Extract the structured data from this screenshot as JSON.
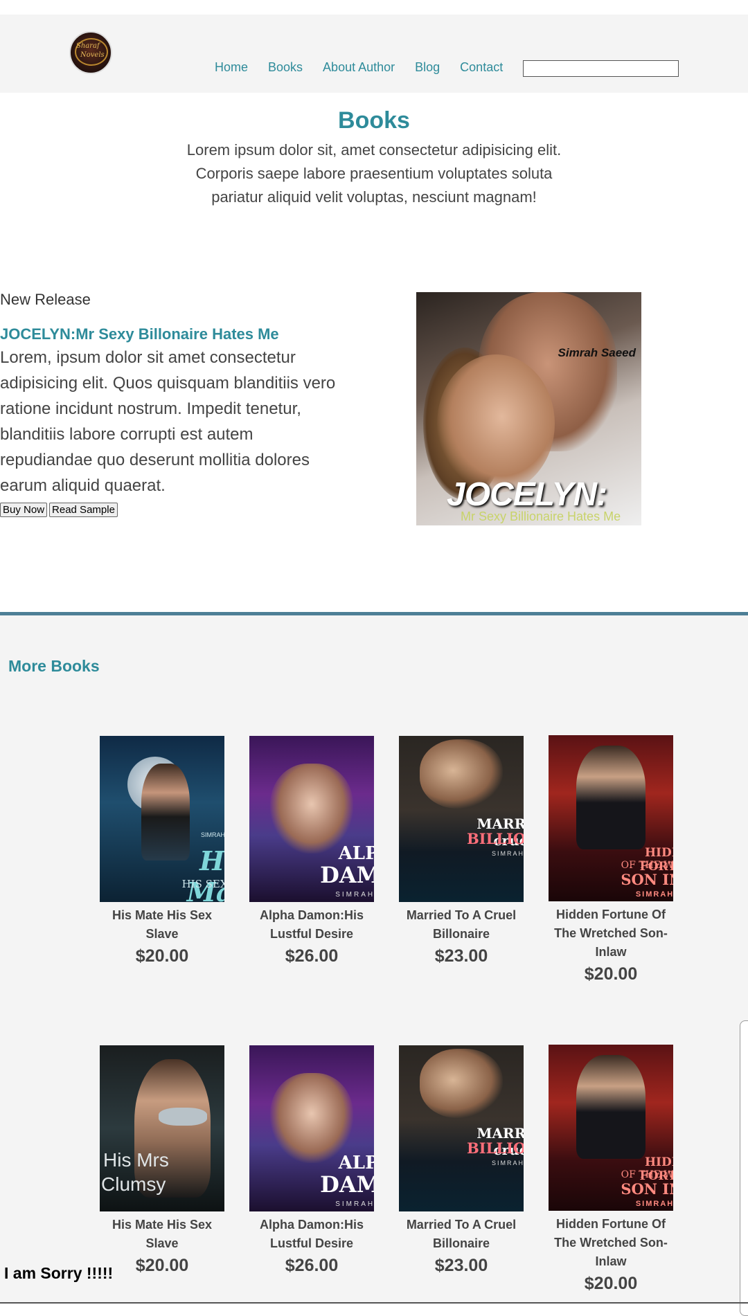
{
  "header": {
    "logo_text_line1": "Sharaf",
    "logo_text_line2": "Novels",
    "nav": [
      "Home",
      "Books",
      "About Author",
      "Blog",
      "Contact"
    ],
    "search_value": ""
  },
  "hero": {
    "title": "Books",
    "description_lines": [
      "Lorem ipsum dolor sit, amet consectetur adipisicing elit.",
      "Corporis saepe labore praesentium voluptates soluta",
      "pariatur aliquid velit voluptas, nesciunt magnam!"
    ]
  },
  "release": {
    "label": "New Release",
    "title": "JOCELYN:Mr Sexy Billonaire Hates Me",
    "description": "Lorem, ipsum dolor sit amet consectetur adipisicing elit. Quos quisquam blanditiis vero ratione incidunt nostrum. Impedit tenetur, blanditiis labore corrupti est autem repudiandae quo deserunt mollitia dolores earum aliquid quaerat.",
    "buy_label": "Buy Now",
    "sample_label": "Read Sample",
    "cover": {
      "author": "Simrah Saeed",
      "title": "JOCELYN:",
      "subtitle": "Mr Sexy Billionaire Hates Me"
    }
  },
  "more_books": {
    "heading": "More Books",
    "rows": [
      [
        {
          "name": "His Mate His Sex Slave",
          "price": "$20.00",
          "cover": {
            "author": "SIMRAH SAEED",
            "line1": "His Mate",
            "line2": "HIS SEX SLAVE"
          }
        },
        {
          "name": "Alpha Damon:His Lustful Desire",
          "price": "$26.00",
          "cover": {
            "line1": "ALPHA",
            "line2": "DAMON:",
            "line3": "SIMRAH SAEED"
          }
        },
        {
          "name": "Married To A Cruel Billonaire",
          "price": "$23.00",
          "cover": {
            "line1": "MARRIED A cruel to",
            "line2": "BILLIONAIRE",
            "line3": "SIMRAH SAEED"
          }
        },
        {
          "name": "Hidden Fortune Of The Wretched Son-Inlaw",
          "price": "$20.00",
          "cover": {
            "line1": "HIDDEN FORTUNE",
            "line2": "OF THE WRETCHED",
            "line3": "SON IN-LAW",
            "line4": "SIMRAH SAEED"
          }
        }
      ],
      [
        {
          "name": "His Mate His Sex Slave",
          "price": "$20.00",
          "cover": {
            "line1": "His Mrs",
            "line2": "Clumsy"
          }
        },
        {
          "name": "Alpha Damon:His Lustful Desire",
          "price": "$26.00",
          "cover": {
            "line1": "ALPHA",
            "line2": "DAMON:",
            "line3": "SIMRAH SAEED"
          }
        },
        {
          "name": "Married To A Cruel Billonaire",
          "price": "$23.00",
          "cover": {
            "line1": "MARRIED A cruel to",
            "line2": "BILLIONAIRE",
            "line3": "SIMRAH SAEED"
          }
        },
        {
          "name": "Hidden Fortune Of The Wretched Son-Inlaw",
          "price": "$20.00",
          "cover": {
            "line1": "HIDDEN FORTUNE",
            "line2": "OF THE WRETCHED",
            "line3": "SON IN-LAW",
            "line4": "SIMRAH SAEED"
          }
        }
      ]
    ]
  },
  "footer_text": "I am Sorry !!!!!",
  "colors": {
    "accent": "#2e8b9a",
    "divider": "#4d7f96",
    "section_bg": "#f4f4f4"
  }
}
